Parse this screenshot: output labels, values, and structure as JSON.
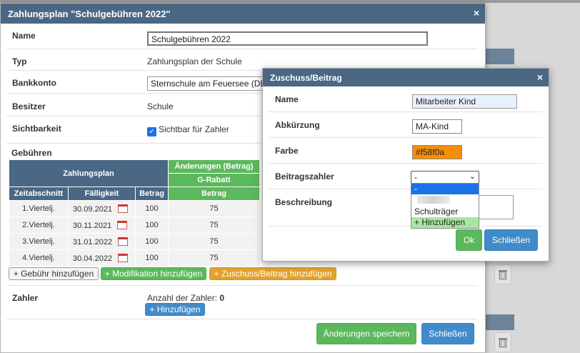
{
  "main": {
    "title": "Zahlungsplan \"Schulgebühren 2022\"",
    "close_icon": "×",
    "fields": {
      "name_label": "Name",
      "name_value": "Schulgebühren 2022",
      "typ_label": "Typ",
      "typ_value": "Zahlungsplan der Schule",
      "bank_label": "Bankkonto",
      "bank_value": "Sternschule am Feuersee (DE",
      "besitzer_label": "Besitzer",
      "besitzer_value": "Schule",
      "sicht_label": "Sichtbarkeit",
      "sicht_value": "Sichtbar für Zahler",
      "sicht_checked": true
    },
    "fees": {
      "section_label": "Gebühren",
      "plan_header": "Zahlungsplan",
      "changes_header": "Änderungen (Betrag)",
      "rabatt_header": "G-Rabatt",
      "columns": [
        "Zeitabschnitt",
        "Fälligkeit",
        "Betrag",
        "Betrag"
      ],
      "rows": [
        {
          "period": "1.Viertelj.",
          "due": "30.09.2021",
          "amount": "100",
          "change": "75"
        },
        {
          "period": "2.Viertelj.",
          "due": "30.11.2021",
          "amount": "100",
          "change": "75"
        },
        {
          "period": "3.Viertelj.",
          "due": "31.01.2022",
          "amount": "100",
          "change": "75"
        },
        {
          "period": "4.Viertelj.",
          "due": "30.04.2022",
          "amount": "100",
          "change": "75"
        }
      ]
    },
    "buttons": {
      "add_fee": "+ Gebühr hinzufügen",
      "add_mod": "+ Modifikation hinzufügen",
      "add_sub": "+ Zuschuss/Beitrag hinzufügen",
      "save": "Änderungen speichern",
      "close": "Schließen"
    },
    "payer": {
      "label": "Zahler",
      "count_text": "Anzahl der Zahler:",
      "count": "0",
      "add": "+ Hinzufügen"
    }
  },
  "sub": {
    "title": "Zuschuss/Beitrag",
    "close_icon": "×",
    "name_label": "Name",
    "name_value": "Mitarbeiter Kind",
    "abbr_label": "Abkürzung",
    "abbr_value": "MA-Kind",
    "color_label": "Farbe",
    "color_value": "#f58f0a",
    "payer_label": "Beitragszahler",
    "payer_selected": "-",
    "desc_label": "Beschreibung",
    "dropdown_options": [
      "-",
      "Schulträger",
      "+ Hinzufügen"
    ],
    "ok": "Ok",
    "close": "Schließen"
  },
  "colors": {
    "header": "#4a6784",
    "green": "#5cb85c",
    "blue": "#428bca",
    "orange": "#e0a22c",
    "color_swatch": "#f58f0a",
    "input_highlight": "#e8f0fe"
  },
  "icons": [
    "close-icon",
    "checkbox-icon",
    "calendar-icon",
    "trash-icon",
    "chevron-down-icon"
  ]
}
